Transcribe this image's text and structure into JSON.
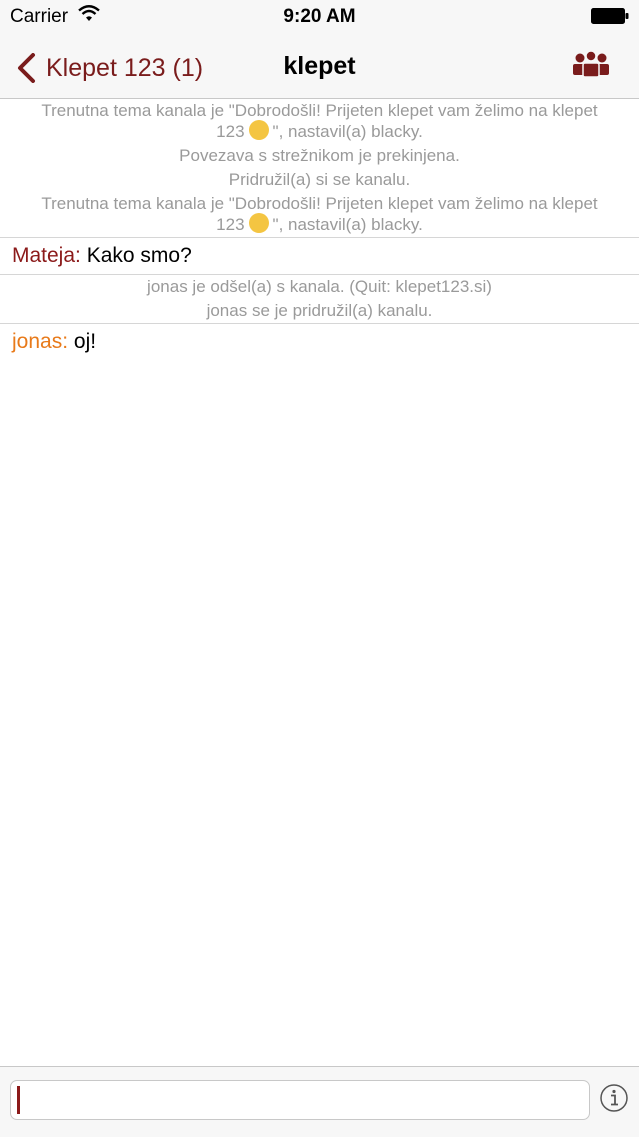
{
  "status_bar": {
    "carrier": "Carrier",
    "time": "9:20 AM",
    "icons": [
      "wifi-icon",
      "battery-icon"
    ]
  },
  "nav": {
    "back_label": "Klepet 123 (1)",
    "title": "klepet",
    "users_icon": "users-icon",
    "accent_color": "#7a1c1c"
  },
  "chat": {
    "system_group_1": {
      "topic_1a": "Trenutna tema kanala je \"Dobrodošli! Prijeten klepet vam želimo na klepet",
      "topic_1b_pre": "123",
      "topic_1b_post": "\", nastavil(a) blacky.",
      "disconnected": "Povezava s strežnikom je prekinjena.",
      "joined": "Pridružil(a) si se kanalu.",
      "topic_2a": "Trenutna tema kanala je \"Dobrodošli! Prijeten klepet vam želimo na klepet",
      "topic_2b_pre": "123",
      "topic_2b_post": "\", nastavil(a) blacky."
    },
    "message_1": {
      "nick": "Mateja:",
      "text": "Kako smo?",
      "nick_color": "#8b1a1a"
    },
    "system_group_2": {
      "quit": "jonas je odšel(a) s kanala. (Quit: klepet123.si)",
      "join": "jonas se je pridružil(a) kanalu."
    },
    "message_2": {
      "nick": "jonas:",
      "text": "oj!",
      "nick_color": "#e87a1a"
    }
  },
  "input": {
    "value": "",
    "placeholder": "",
    "info_icon": "info-icon"
  }
}
